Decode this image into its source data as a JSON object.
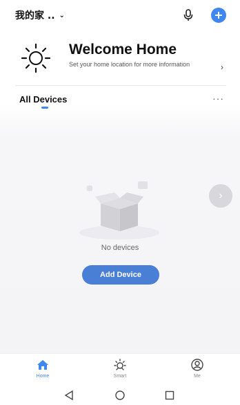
{
  "topbar": {
    "home_name": "我的家 ..",
    "home_chevron": "⌄",
    "mic_icon": "microphone-icon",
    "add_icon": "plus-circle-icon",
    "accent_color": "#3f86f1"
  },
  "welcome": {
    "title": "Welcome Home",
    "subtitle": "Set your home location for more information",
    "icon": "sun-icon",
    "chevron": "›"
  },
  "devices": {
    "tab_label": "All Devices",
    "more_label": "···",
    "empty_text": "No devices",
    "add_button_label": "Add Device",
    "side_arrow": "›"
  },
  "bottom_nav": {
    "items": [
      {
        "label": "Home",
        "icon": "home-icon",
        "active": true
      },
      {
        "label": "Smart",
        "icon": "smart-sun-icon",
        "active": false
      },
      {
        "label": "Me",
        "icon": "profile-icon",
        "active": false
      }
    ]
  },
  "system_bar": {
    "buttons": [
      "back-triangle-icon",
      "home-circle-icon",
      "recents-square-icon"
    ]
  }
}
